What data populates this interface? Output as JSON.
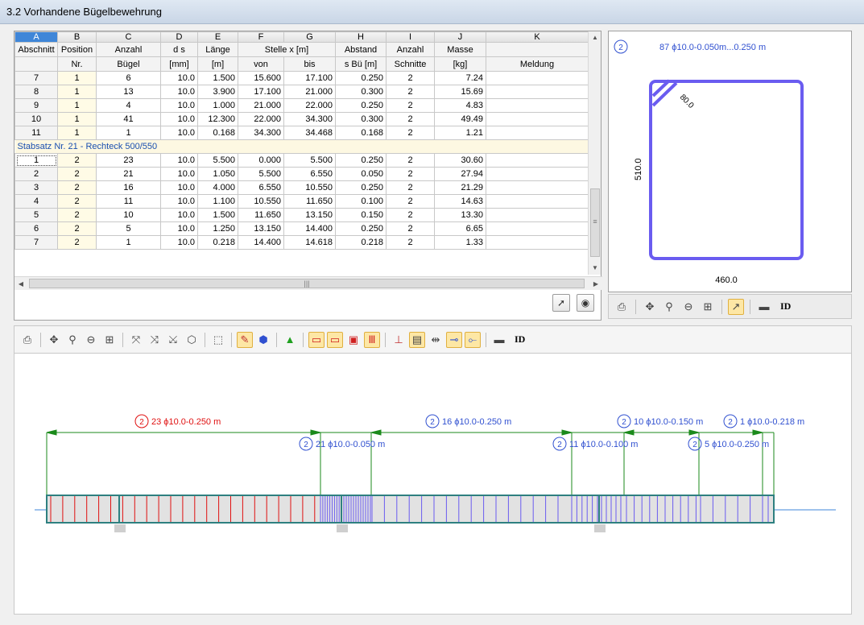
{
  "window": {
    "title": "3.2 Vorhandene Bügelbewehrung"
  },
  "table": {
    "col_letters": [
      "A",
      "B",
      "C",
      "D",
      "E",
      "F",
      "G",
      "H",
      "I",
      "J",
      "K"
    ],
    "header1": [
      "Abschnitt",
      "Position",
      "Anzahl",
      "d s",
      "Länge",
      "Stelle x [m]",
      "Abstand",
      "Anzahl",
      "Masse",
      ""
    ],
    "header2": [
      "",
      "Nr.",
      "Bügel",
      "[mm]",
      "[m]",
      "von",
      "bis",
      "s Bü [m]",
      "Schnitte",
      "[kg]",
      "Meldung"
    ],
    "rows_top": [
      [
        "7",
        "1",
        "6",
        "10.0",
        "1.500",
        "15.600",
        "17.100",
        "0.250",
        "2",
        "7.24",
        ""
      ],
      [
        "8",
        "1",
        "13",
        "10.0",
        "3.900",
        "17.100",
        "21.000",
        "0.300",
        "2",
        "15.69",
        ""
      ],
      [
        "9",
        "1",
        "4",
        "10.0",
        "1.000",
        "21.000",
        "22.000",
        "0.250",
        "2",
        "4.83",
        ""
      ],
      [
        "10",
        "1",
        "41",
        "10.0",
        "12.300",
        "22.000",
        "34.300",
        "0.300",
        "2",
        "49.49",
        ""
      ],
      [
        "11",
        "1",
        "1",
        "10.0",
        "0.168",
        "34.300",
        "34.468",
        "0.168",
        "2",
        "1.21",
        ""
      ]
    ],
    "group_label": "Stabsatz Nr. 21  -  Rechteck 500/550",
    "rows_bottom": [
      [
        "1",
        "2",
        "23",
        "10.0",
        "5.500",
        "0.000",
        "5.500",
        "0.250",
        "2",
        "30.60",
        ""
      ],
      [
        "2",
        "2",
        "21",
        "10.0",
        "1.050",
        "5.500",
        "6.550",
        "0.050",
        "2",
        "27.94",
        ""
      ],
      [
        "3",
        "2",
        "16",
        "10.0",
        "4.000",
        "6.550",
        "10.550",
        "0.250",
        "2",
        "21.29",
        ""
      ],
      [
        "4",
        "2",
        "11",
        "10.0",
        "1.100",
        "10.550",
        "11.650",
        "0.100",
        "2",
        "14.63",
        ""
      ],
      [
        "5",
        "2",
        "10",
        "10.0",
        "1.500",
        "11.650",
        "13.150",
        "0.150",
        "2",
        "13.30",
        ""
      ],
      [
        "6",
        "2",
        "5",
        "10.0",
        "1.250",
        "13.150",
        "14.400",
        "0.250",
        "2",
        "6.65",
        ""
      ],
      [
        "7",
        "2",
        "1",
        "10.0",
        "0.218",
        "14.400",
        "14.618",
        "0.218",
        "2",
        "1.33",
        ""
      ]
    ]
  },
  "shape": {
    "position_badge": "2",
    "caption": "87 ϕ10.0-0.050m...0.250 m",
    "hook_label": "80.0",
    "height_label": "510.0",
    "width_label": "460.0"
  },
  "beam": {
    "labels": [
      {
        "badge": "2",
        "text": "23 ϕ10.0-0.250 m",
        "color": "#e01010"
      },
      {
        "badge": "2",
        "text": "21 ϕ10.0-0.050 m",
        "color": "#3050d0"
      },
      {
        "badge": "2",
        "text": "16 ϕ10.0-0.250 m",
        "color": "#3050d0"
      },
      {
        "badge": "2",
        "text": "11 ϕ10.0-0.100 m",
        "color": "#3050d0"
      },
      {
        "badge": "2",
        "text": "10 ϕ10.0-0.150 m",
        "color": "#3050d0"
      },
      {
        "badge": "2",
        "text": "5 ϕ10.0-0.250 m",
        "color": "#3050d0"
      },
      {
        "badge": "2",
        "text": "1 ϕ10.0-0.218 m",
        "color": "#3050d0"
      }
    ]
  },
  "toolbar": {
    "id_label": "ID",
    "shape_id_label": "ID"
  },
  "colors": {
    "accent": "#3f86d8",
    "dimension": "#1b8a1b",
    "stirrup_blue": "#6a5cf0",
    "stirrup_red": "#e01010"
  }
}
